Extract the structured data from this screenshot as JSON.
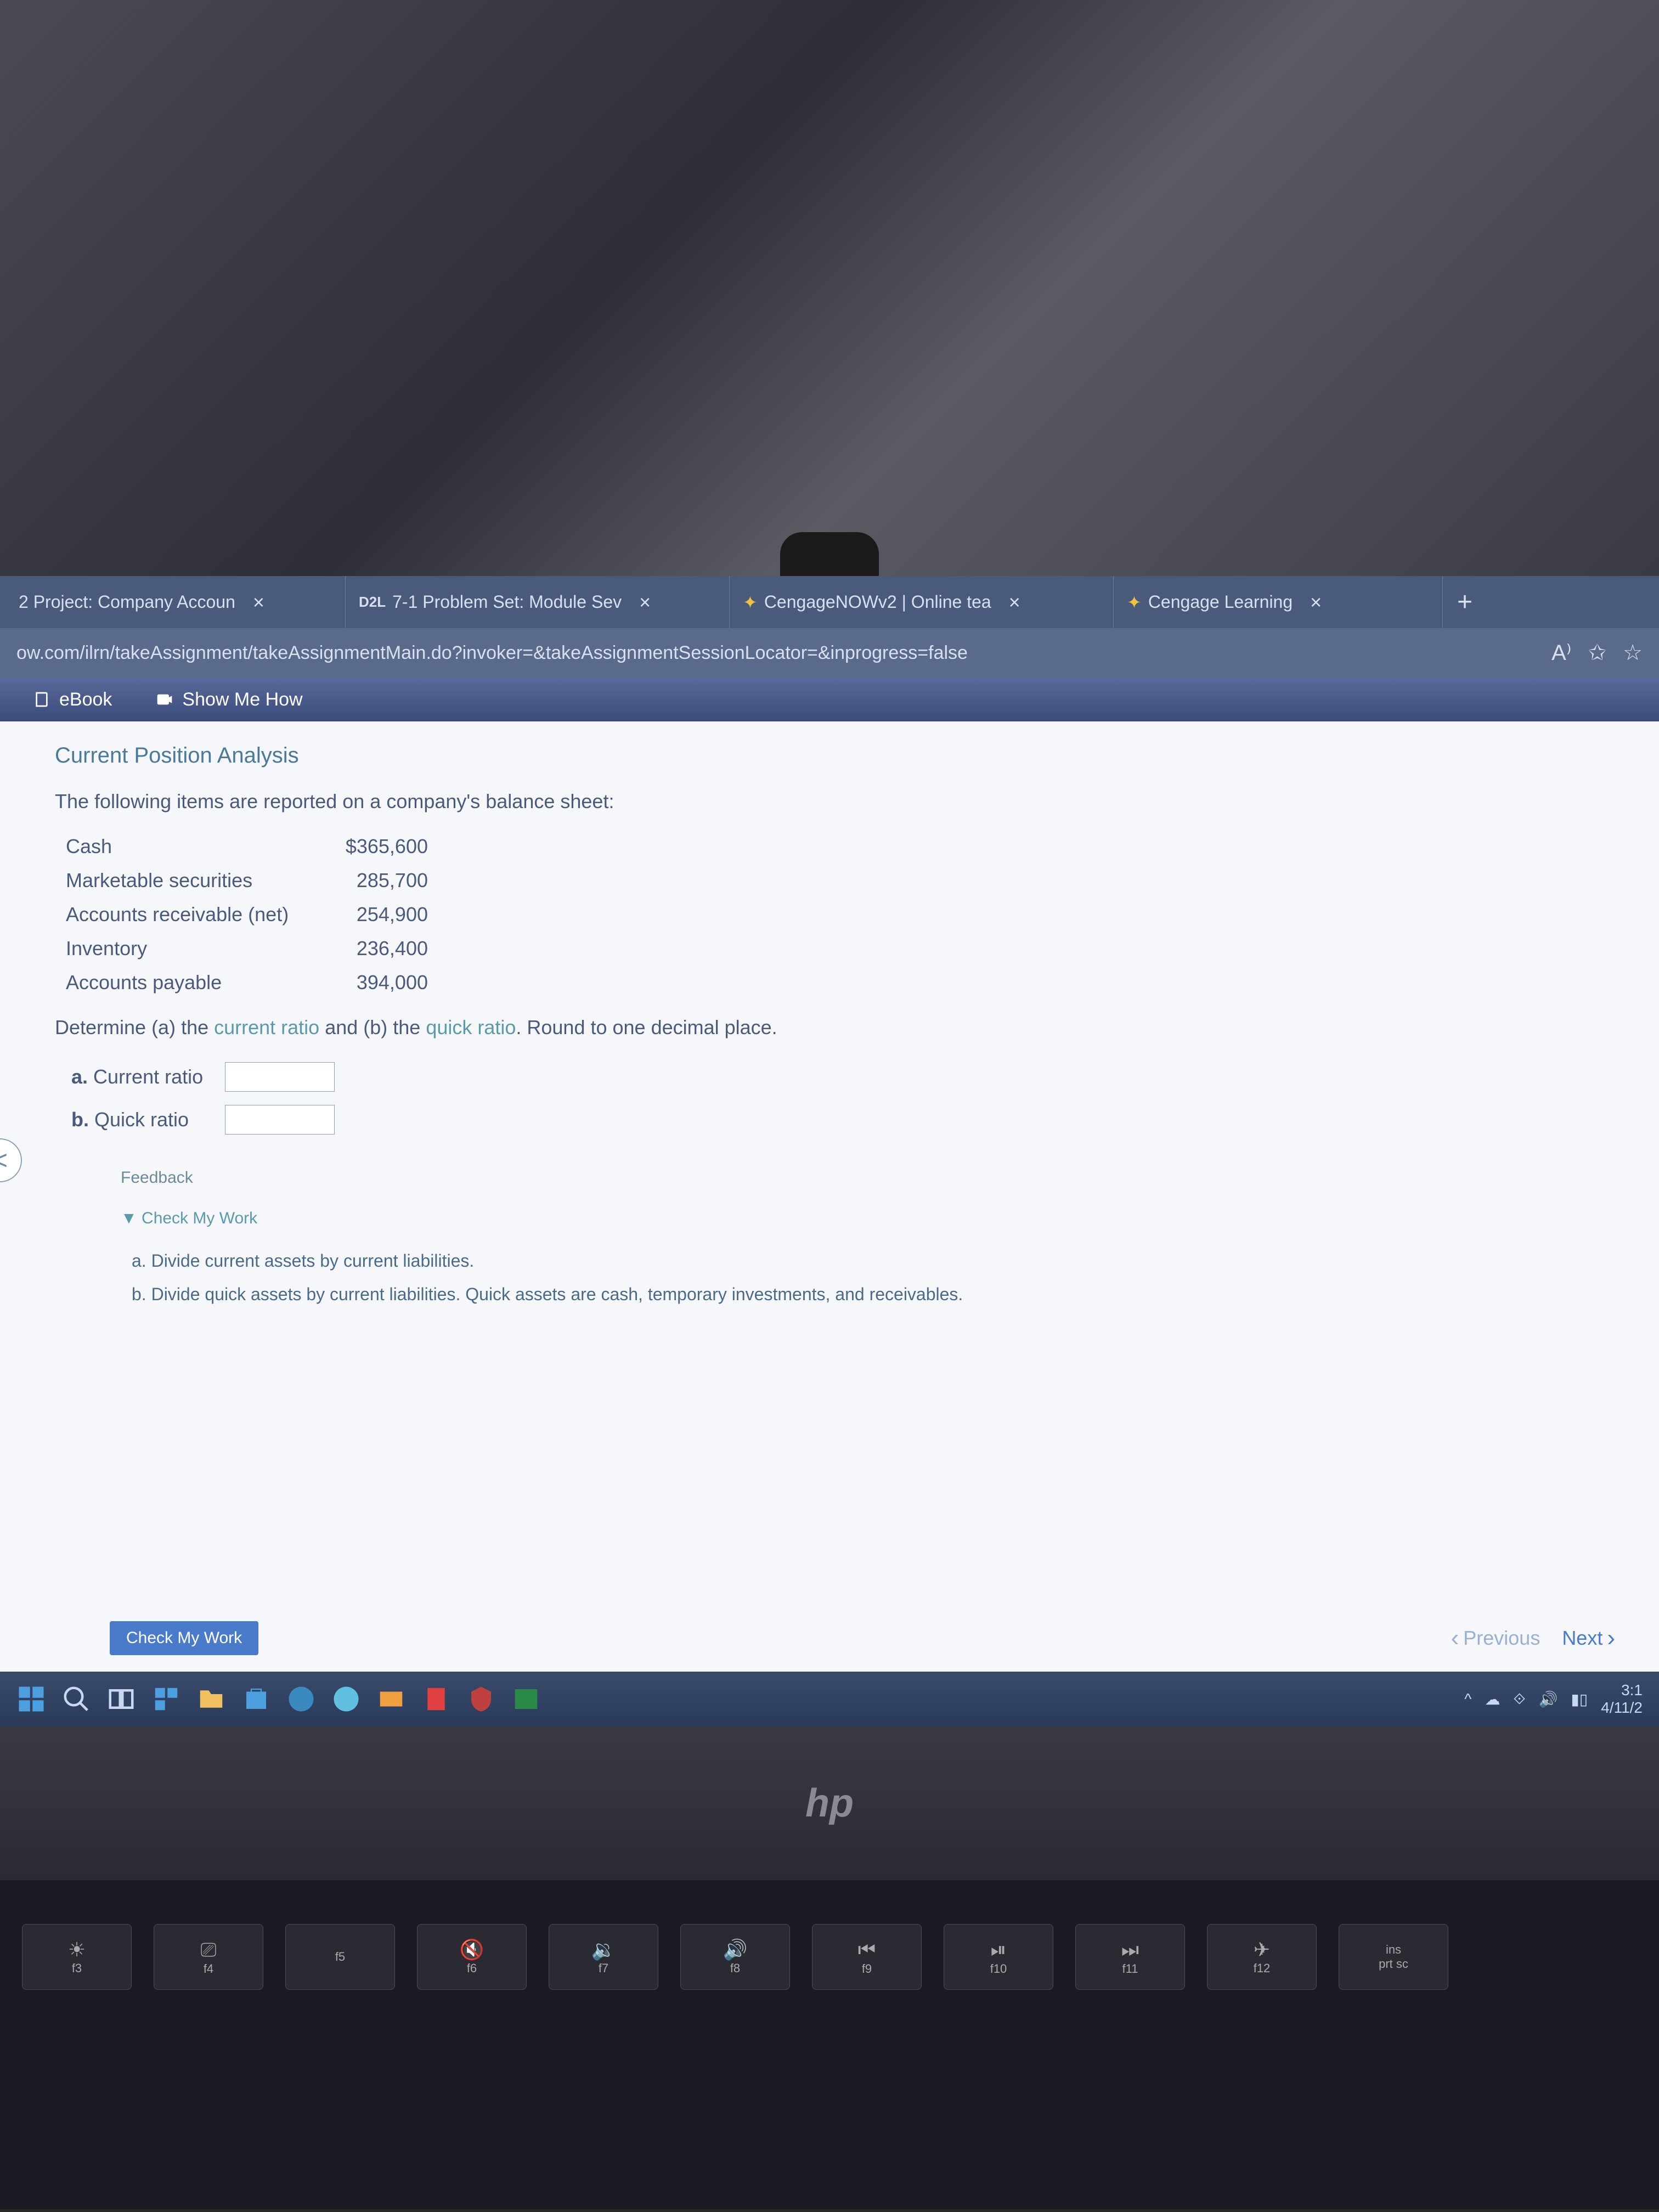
{
  "tabs": [
    {
      "label": "2 Project: Company Accoun",
      "icon": ""
    },
    {
      "label": "7-1 Problem Set: Module Sev",
      "icon": "D2L"
    },
    {
      "label": "CengageNOWv2 | Online tea",
      "icon": "✦"
    },
    {
      "label": "Cengage Learning",
      "icon": "✦"
    }
  ],
  "url": "ow.com/ilrn/takeAssignment/takeAssignmentMain.do?invoker=&takeAssignmentSessionLocator=&inprogress=false",
  "toolbar": {
    "ebook": "eBook",
    "show_me": "Show Me How"
  },
  "content": {
    "title": "Current Position Analysis",
    "intro": "The following items are reported on a company's balance sheet:",
    "balance": [
      {
        "label": "Cash",
        "value": "$365,600"
      },
      {
        "label": "Marketable securities",
        "value": "285,700"
      },
      {
        "label": "Accounts receivable (net)",
        "value": "254,900"
      },
      {
        "label": "Inventory",
        "value": "236,400"
      },
      {
        "label": "Accounts payable",
        "value": "394,000"
      }
    ],
    "determine_pre": "Determine (a) the ",
    "determine_a": "current ratio",
    "determine_mid": " and (b) the ",
    "determine_b": "quick ratio",
    "determine_post": ". Round to one decimal place.",
    "answers": [
      {
        "letter": "a.",
        "label": "Current ratio"
      },
      {
        "letter": "b.",
        "label": "Quick ratio"
      }
    ],
    "feedback_title": "Feedback",
    "check_work": "▼ Check My Work",
    "feedback_items": [
      "a. Divide current assets by current liabilities.",
      "b. Divide quick assets by current liabilities. Quick assets are cash, temporary investments, and receivables."
    ],
    "check_btn": "Check My Work",
    "prev": "Previous",
    "next": "Next"
  },
  "taskbar": {
    "time": "3:1",
    "date": "4/11/2"
  },
  "keys": [
    "f3",
    "f4",
    "f5",
    "f6",
    "f7",
    "f8",
    "f9",
    "f10",
    "f11",
    "f12",
    "ins"
  ]
}
